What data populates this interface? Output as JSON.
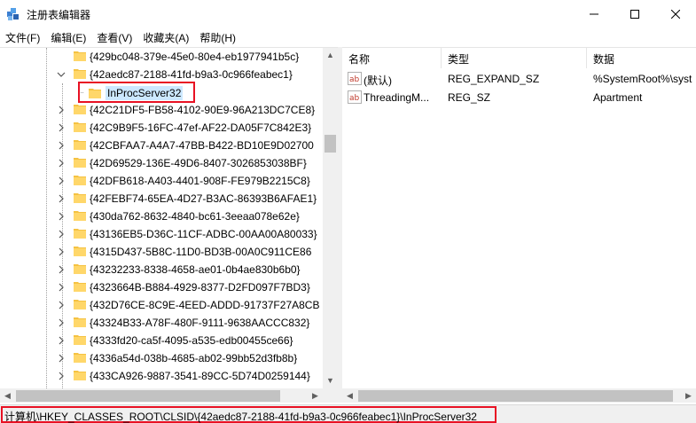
{
  "window": {
    "title": "注册表编辑器",
    "app_icon": "regedit-icon",
    "controls": {
      "minimize": "—",
      "maximize": "☐",
      "close": "✕"
    }
  },
  "menu": {
    "file": "文件(F)",
    "edit": "编辑(E)",
    "view": "查看(V)",
    "favorites": "收藏夹(A)",
    "help": "帮助(H)"
  },
  "tree": {
    "parent_above": "{429bc048-379e-45e0-80e4-eb1977941b5c}",
    "expanded_key": "{42aedc87-2188-41fd-b9a3-0c966feabec1}",
    "selected_key": "InProcServer32",
    "keys_below": [
      "{42C21DF5-FB58-4102-90E9-96A213DC7CE8}",
      "{42C9B9F5-16FC-47ef-AF22-DA05F7C842E3}",
      "{42CBFAA7-A4A7-47BB-B422-BD10E9D02700",
      "{42D69529-136E-49D6-8407-3026853038BF}",
      "{42DFB618-A403-4401-908F-FE979B2215C8}",
      "{42FEBF74-65EA-4D27-B3AC-86393B6AFAE1}",
      "{430da762-8632-4840-bc61-3eeaa078e62e}",
      "{43136EB5-D36C-11CF-ADBC-00AA00A80033}",
      "{4315D437-5B8C-11D0-BD3B-00A0C911CE86",
      "{43232233-8338-4658-ae01-0b4ae830b6b0}",
      "{4323664B-B884-4929-8377-D2FD097F7BD3}",
      "{432D76CE-8C9E-4EED-ADDD-91737F27A8CB",
      "{43324B33-A78F-480F-9111-9638AACCC832}",
      "{4333fd20-ca5f-4095-a535-edb00455ce66}",
      "{4336a54d-038b-4685-ab02-99bb52d3fb8b}",
      "{433CA926-9887-3541-89CC-5D74D0259144}"
    ]
  },
  "list": {
    "headers": {
      "name": "名称",
      "type": "类型",
      "data": "数据"
    },
    "values": [
      {
        "name": "(默认)",
        "type": "REG_EXPAND_SZ",
        "data": "%SystemRoot%\\syst"
      },
      {
        "name": "ThreadingM...",
        "type": "REG_SZ",
        "data": "Apartment"
      }
    ]
  },
  "status": {
    "path": "计算机\\HKEY_CLASSES_ROOT\\CLSID\\{42aedc87-2188-41fd-b9a3-0c966feabec1}\\InProcServer32"
  },
  "colors": {
    "highlight_border": "#e81123",
    "selection_bg": "#cce8ff",
    "folder": "#f5c242"
  }
}
